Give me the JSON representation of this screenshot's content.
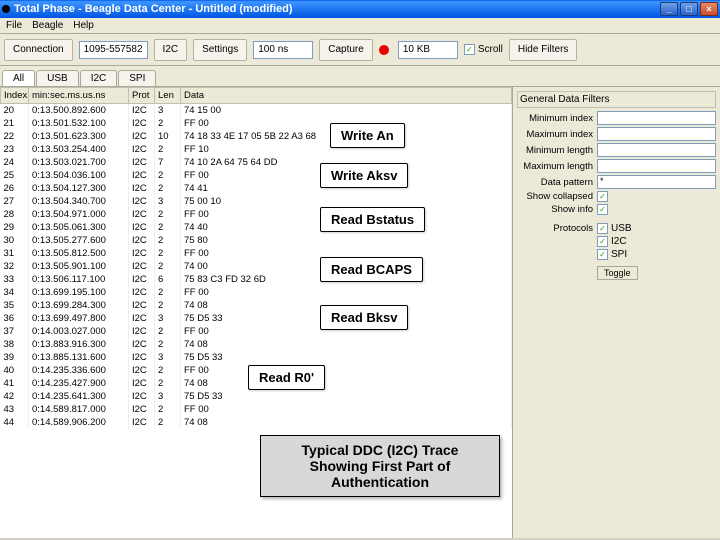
{
  "window": {
    "title": "Total Phase - Beagle Data Center - Untitled (modified)"
  },
  "menu": {
    "file": "File",
    "beagle": "Beagle",
    "help": "Help"
  },
  "toolbar": {
    "connection": "Connection",
    "serial": "1095-557582",
    "proto": "I2C",
    "settings": "Settings",
    "sample": "100 ns",
    "capture": "Capture",
    "buffer": "10 KB",
    "scroll": "Scroll",
    "hide_filters": "Hide Filters"
  },
  "tabs": {
    "all": "All",
    "usb": "USB",
    "i2c": "I2C",
    "spi": "SPI"
  },
  "columns": {
    "index": "Index",
    "time": "min:sec.ms.us.ns",
    "prot": "Prot",
    "len": "Len",
    "data": "Data"
  },
  "rows": [
    {
      "idx": "20",
      "time": "0:13.500.892.600",
      "prot": "I2C",
      "len": "3",
      "data": "74 15 00"
    },
    {
      "idx": "21",
      "time": "0:13.501.532.100",
      "prot": "I2C",
      "len": "2",
      "data": "FF 00"
    },
    {
      "idx": "22",
      "time": "0:13.501.623.300",
      "prot": "I2C",
      "len": "10",
      "data": "74 18 33 4E 17 05 5B 22 A3 68"
    },
    {
      "idx": "23",
      "time": "0:13.503.254.400",
      "prot": "I2C",
      "len": "2",
      "data": "FF 10"
    },
    {
      "idx": "24",
      "time": "0:13.503.021.700",
      "prot": "I2C",
      "len": "7",
      "data": "74 10 2A 64 75 64 DD"
    },
    {
      "idx": "25",
      "time": "0:13.504.036.100",
      "prot": "I2C",
      "len": "2",
      "data": "FF 00"
    },
    {
      "idx": "26",
      "time": "0:13.504.127.300",
      "prot": "I2C",
      "len": "2",
      "data": "74 41"
    },
    {
      "idx": "27",
      "time": "0:13.504.340.700",
      "prot": "I2C",
      "len": "3",
      "data": "75 00 10"
    },
    {
      "idx": "28",
      "time": "0:13.504.971.000",
      "prot": "I2C",
      "len": "2",
      "data": "FF 00"
    },
    {
      "idx": "29",
      "time": "0:13.505.061.300",
      "prot": "I2C",
      "len": "2",
      "data": "74 40"
    },
    {
      "idx": "30",
      "time": "0:13.505.277.600",
      "prot": "I2C",
      "len": "2",
      "data": "75 80"
    },
    {
      "idx": "31",
      "time": "0:13.505.812.500",
      "prot": "I2C",
      "len": "2",
      "data": "FF 00"
    },
    {
      "idx": "32",
      "time": "0:13.505.901.100",
      "prot": "I2C",
      "len": "2",
      "data": "74 00"
    },
    {
      "idx": "33",
      "time": "0:13.506.117.100",
      "prot": "I2C",
      "len": "6",
      "data": "75 83 C3 FD 32 6D"
    },
    {
      "idx": "34",
      "time": "0:13.699.195.100",
      "prot": "I2C",
      "len": "2",
      "data": "FF 00"
    },
    {
      "idx": "35",
      "time": "0:13.699.284.300",
      "prot": "I2C",
      "len": "2",
      "data": "74 08"
    },
    {
      "idx": "36",
      "time": "0:13.699.497.800",
      "prot": "I2C",
      "len": "3",
      "data": "75 D5 33"
    },
    {
      "idx": "37",
      "time": "0:14.003.027.000",
      "prot": "I2C",
      "len": "2",
      "data": "FF 00"
    },
    {
      "idx": "38",
      "time": "0:13.883.916.300",
      "prot": "I2C",
      "len": "2",
      "data": "74 08"
    },
    {
      "idx": "39",
      "time": "0:13.885.131.600",
      "prot": "I2C",
      "len": "3",
      "data": "75 D5 33"
    },
    {
      "idx": "40",
      "time": "0:14.235.336.600",
      "prot": "I2C",
      "len": "2",
      "data": "FF 00"
    },
    {
      "idx": "41",
      "time": "0:14.235.427.900",
      "prot": "I2C",
      "len": "2",
      "data": "74 08"
    },
    {
      "idx": "42",
      "time": "0:14.235.641.300",
      "prot": "I2C",
      "len": "3",
      "data": "75 D5 33"
    },
    {
      "idx": "43",
      "time": "0:14.589.817.000",
      "prot": "I2C",
      "len": "2",
      "data": "FF 00"
    },
    {
      "idx": "44",
      "time": "0:14.589.906.200",
      "prot": "I2C",
      "len": "2",
      "data": "74 08"
    }
  ],
  "filters": {
    "header": "General Data Filters",
    "min_index": "Minimum index",
    "max_index": "Maximum index",
    "min_len": "Minimum length",
    "max_len": "Maximum length",
    "data_pattern": "Data pattern",
    "pattern_val": "*",
    "show_collapsed": "Show collapsed",
    "show_info": "Show info",
    "protocols": "Protocols",
    "usb": "USB",
    "i2c": "I2C",
    "spi": "SPI",
    "toggle": "Toggle"
  },
  "callouts": {
    "an": "Write An",
    "aksv": "Write Aksv",
    "bstatus": "Read Bstatus",
    "bcaps": "Read BCAPS",
    "bksv": "Read Bksv",
    "r0": "Read R0'",
    "big": "Typical DDC (I2C) Trace Showing First Part of Authentication"
  }
}
